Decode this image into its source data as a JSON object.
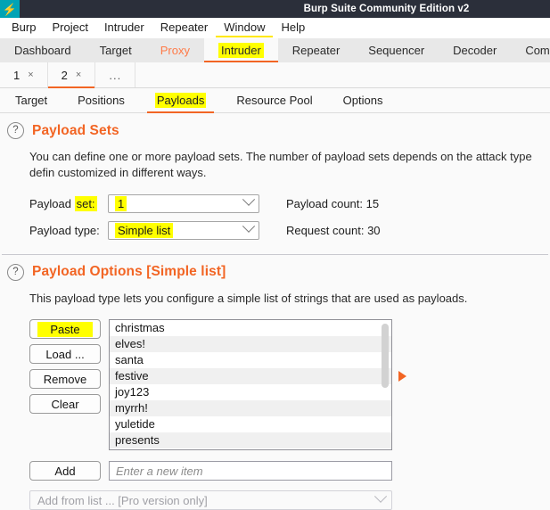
{
  "titlebar": {
    "app_title": "Burp Suite Community Edition v2",
    "logo_icon": "burp-bolt-icon"
  },
  "menubar": {
    "items": [
      {
        "label": "Burp"
      },
      {
        "label": "Project"
      },
      {
        "label": "Intruder"
      },
      {
        "label": "Repeater"
      },
      {
        "label": "Window"
      },
      {
        "label": "Help"
      }
    ]
  },
  "main_tabs": [
    {
      "label": "Dashboard",
      "selected": false,
      "highlighted": false
    },
    {
      "label": "Target",
      "selected": false,
      "highlighted": false
    },
    {
      "label": "Proxy",
      "selected": false,
      "highlighted": false
    },
    {
      "label": "Intruder",
      "selected": true,
      "highlighted": true
    },
    {
      "label": "Repeater",
      "selected": false,
      "highlighted": false
    },
    {
      "label": "Sequencer",
      "selected": false,
      "highlighted": false
    },
    {
      "label": "Decoder",
      "selected": false,
      "highlighted": false
    },
    {
      "label": "Compa",
      "selected": false,
      "highlighted": false
    }
  ],
  "attack_tabs": [
    {
      "label": "1",
      "close": "×",
      "selected": false
    },
    {
      "label": "2",
      "close": "×",
      "selected": true
    }
  ],
  "attack_tabs_overflow": "...",
  "sub_tabs": [
    {
      "label": "Target",
      "selected": false,
      "highlighted": false
    },
    {
      "label": "Positions",
      "selected": false,
      "highlighted": false
    },
    {
      "label": "Payloads",
      "selected": true,
      "highlighted": true
    },
    {
      "label": "Resource Pool",
      "selected": false,
      "highlighted": false
    },
    {
      "label": "Options",
      "selected": false,
      "highlighted": false
    }
  ],
  "payload_sets": {
    "help_icon": "?",
    "title": "Payload Sets",
    "description": "You can define one or more payload sets. The number of payload sets depends on the attack type defin customized in different ways.",
    "set_label_prefix": "Payload ",
    "set_label_highlight": "set:",
    "set_value": "1",
    "type_label": "Payload type:",
    "type_value": "Simple list",
    "payload_count_label": "Payload count:",
    "payload_count_value": "15",
    "request_count_label": "Request count:",
    "request_count_value": "30"
  },
  "payload_options": {
    "help_icon": "?",
    "title": "Payload Options [Simple list]",
    "description": "This payload type lets you configure a simple list of strings that are used as payloads.",
    "buttons": [
      {
        "label": "Paste",
        "highlighted": true
      },
      {
        "label": "Load ...",
        "highlighted": false
      },
      {
        "label": "Remove",
        "highlighted": false
      },
      {
        "label": "Clear",
        "highlighted": false
      }
    ],
    "list_items": [
      "christmas",
      "elves!",
      "santa",
      "festive",
      "joy123",
      "myrrh!",
      "yuletide",
      "presents"
    ],
    "marker_icon": "orange-right-triangle",
    "add_button_label": "Add",
    "add_input_placeholder": "Enter a new item",
    "add_input_value": "",
    "add_from_list_label": "Add from list ... [Pro version only]"
  },
  "colors": {
    "accent_orange": "#f26524",
    "highlight_yellow": "#ffff00",
    "titlebar_bg": "#2b2f3a",
    "logo_teal": "#00a3b5"
  }
}
